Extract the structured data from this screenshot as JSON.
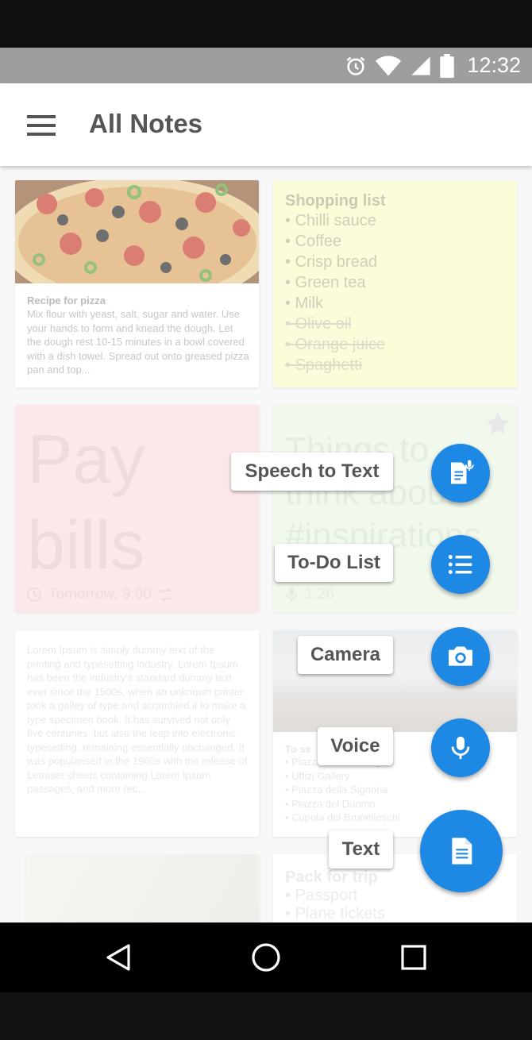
{
  "status": {
    "time": "12:32"
  },
  "app": {
    "title": "All Notes"
  },
  "notes": {
    "pizza": {
      "title": "Recipe for pizza",
      "body": "Mix flour with yeast, salt, sugar and water. Use your hands to form and knead the dough. Let the dough rest 10-15 minutes in a bowl covered with a dish towel. Spread out onto greased pizza pan and top..."
    },
    "shopping": {
      "title": "Shopping list",
      "items": [
        "Chilli sauce",
        "Coffee",
        "Crisp bread",
        "Green tea",
        "Milk"
      ],
      "done_items": [
        "Olive oil",
        "Orange juice",
        "Spaghetti"
      ]
    },
    "bills": {
      "line1": "Pay",
      "line2": "bills",
      "reminder": "Tomorrow, 9:00"
    },
    "things": {
      "line1": "Things to",
      "line2": "think about",
      "line3": "#inspirations",
      "duration": "1:26"
    },
    "lorem": {
      "body": "Lorem Ipsum is simply dummy text of the printing and typesetting industry. Lorem Ipsum has been the industry's standard dummy text ever since the 1500s, when an unknown printer took a galley of type and scrambled it to make a type specimen book. It has survived not only five centuries, but also the leap into electronic typesetting, remaining essentially unchanged. It was popularised in the 1960s with the release of Letraset sheets containing Lorem Ipsum passages, and more rec..."
    },
    "florence": {
      "title": "To se",
      "items": [
        "Piazzale Michelangelo",
        "Uffizi Gallery",
        "Piazza della Signoria",
        "Piazza del Duomo",
        "Cupola del Brunelleschi"
      ]
    },
    "trip": {
      "title": "Pack for trip",
      "items": [
        "Passport",
        "Plane tickets"
      ]
    }
  },
  "fab_menu": {
    "speech": "Speech to Text",
    "todo": "To-Do List",
    "camera": "Camera",
    "voice": "Voice",
    "text": "Text"
  },
  "colors": {
    "accent": "#1e88e5",
    "status_bar": "#9e9e9e"
  }
}
